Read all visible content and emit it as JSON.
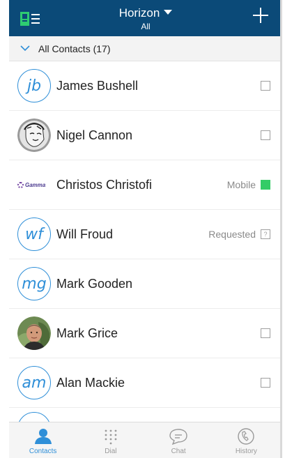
{
  "header": {
    "title": "Horizon",
    "subtitle": "All",
    "menu_icon": "contacts-menu-icon",
    "add_icon": "plus-icon"
  },
  "filter": {
    "label": "All Contacts (17)",
    "icon": "chevron-down-icon"
  },
  "contacts": [
    {
      "name": "James Bushell",
      "avatar_initials": "jb",
      "avatar_type": "initials",
      "right_text": "",
      "right_indicator": "checkbox"
    },
    {
      "name": "Nigel Cannon",
      "avatar_type": "photo",
      "right_text": "",
      "right_indicator": "checkbox"
    },
    {
      "name": "Christos Christofi",
      "avatar_type": "logo",
      "logo_text": "Gamma",
      "right_text": "Mobile",
      "right_indicator": "green-square"
    },
    {
      "name": "Will Froud",
      "avatar_initials": "wf",
      "avatar_type": "initials",
      "right_text": "Requested",
      "right_indicator": "requested-icon"
    },
    {
      "name": "Mark Gooden",
      "avatar_initials": "mg",
      "avatar_type": "initials",
      "right_text": "",
      "right_indicator": "none"
    },
    {
      "name": "Mark Grice",
      "avatar_type": "photo",
      "right_text": "",
      "right_indicator": "checkbox"
    },
    {
      "name": "Alan Mackie",
      "avatar_initials": "am",
      "avatar_type": "initials",
      "right_text": "",
      "right_indicator": "checkbox"
    }
  ],
  "tabs": [
    {
      "label": "Contacts",
      "icon": "person-icon",
      "active": true
    },
    {
      "label": "Dial",
      "icon": "dialpad-icon",
      "active": false
    },
    {
      "label": "Chat",
      "icon": "chat-bubble-icon",
      "active": false
    },
    {
      "label": "History",
      "icon": "clock-phone-icon",
      "active": false
    }
  ],
  "colors": {
    "header_bg": "#0b4a78",
    "accent": "#2f8fd8",
    "status_green": "#33cc66"
  }
}
